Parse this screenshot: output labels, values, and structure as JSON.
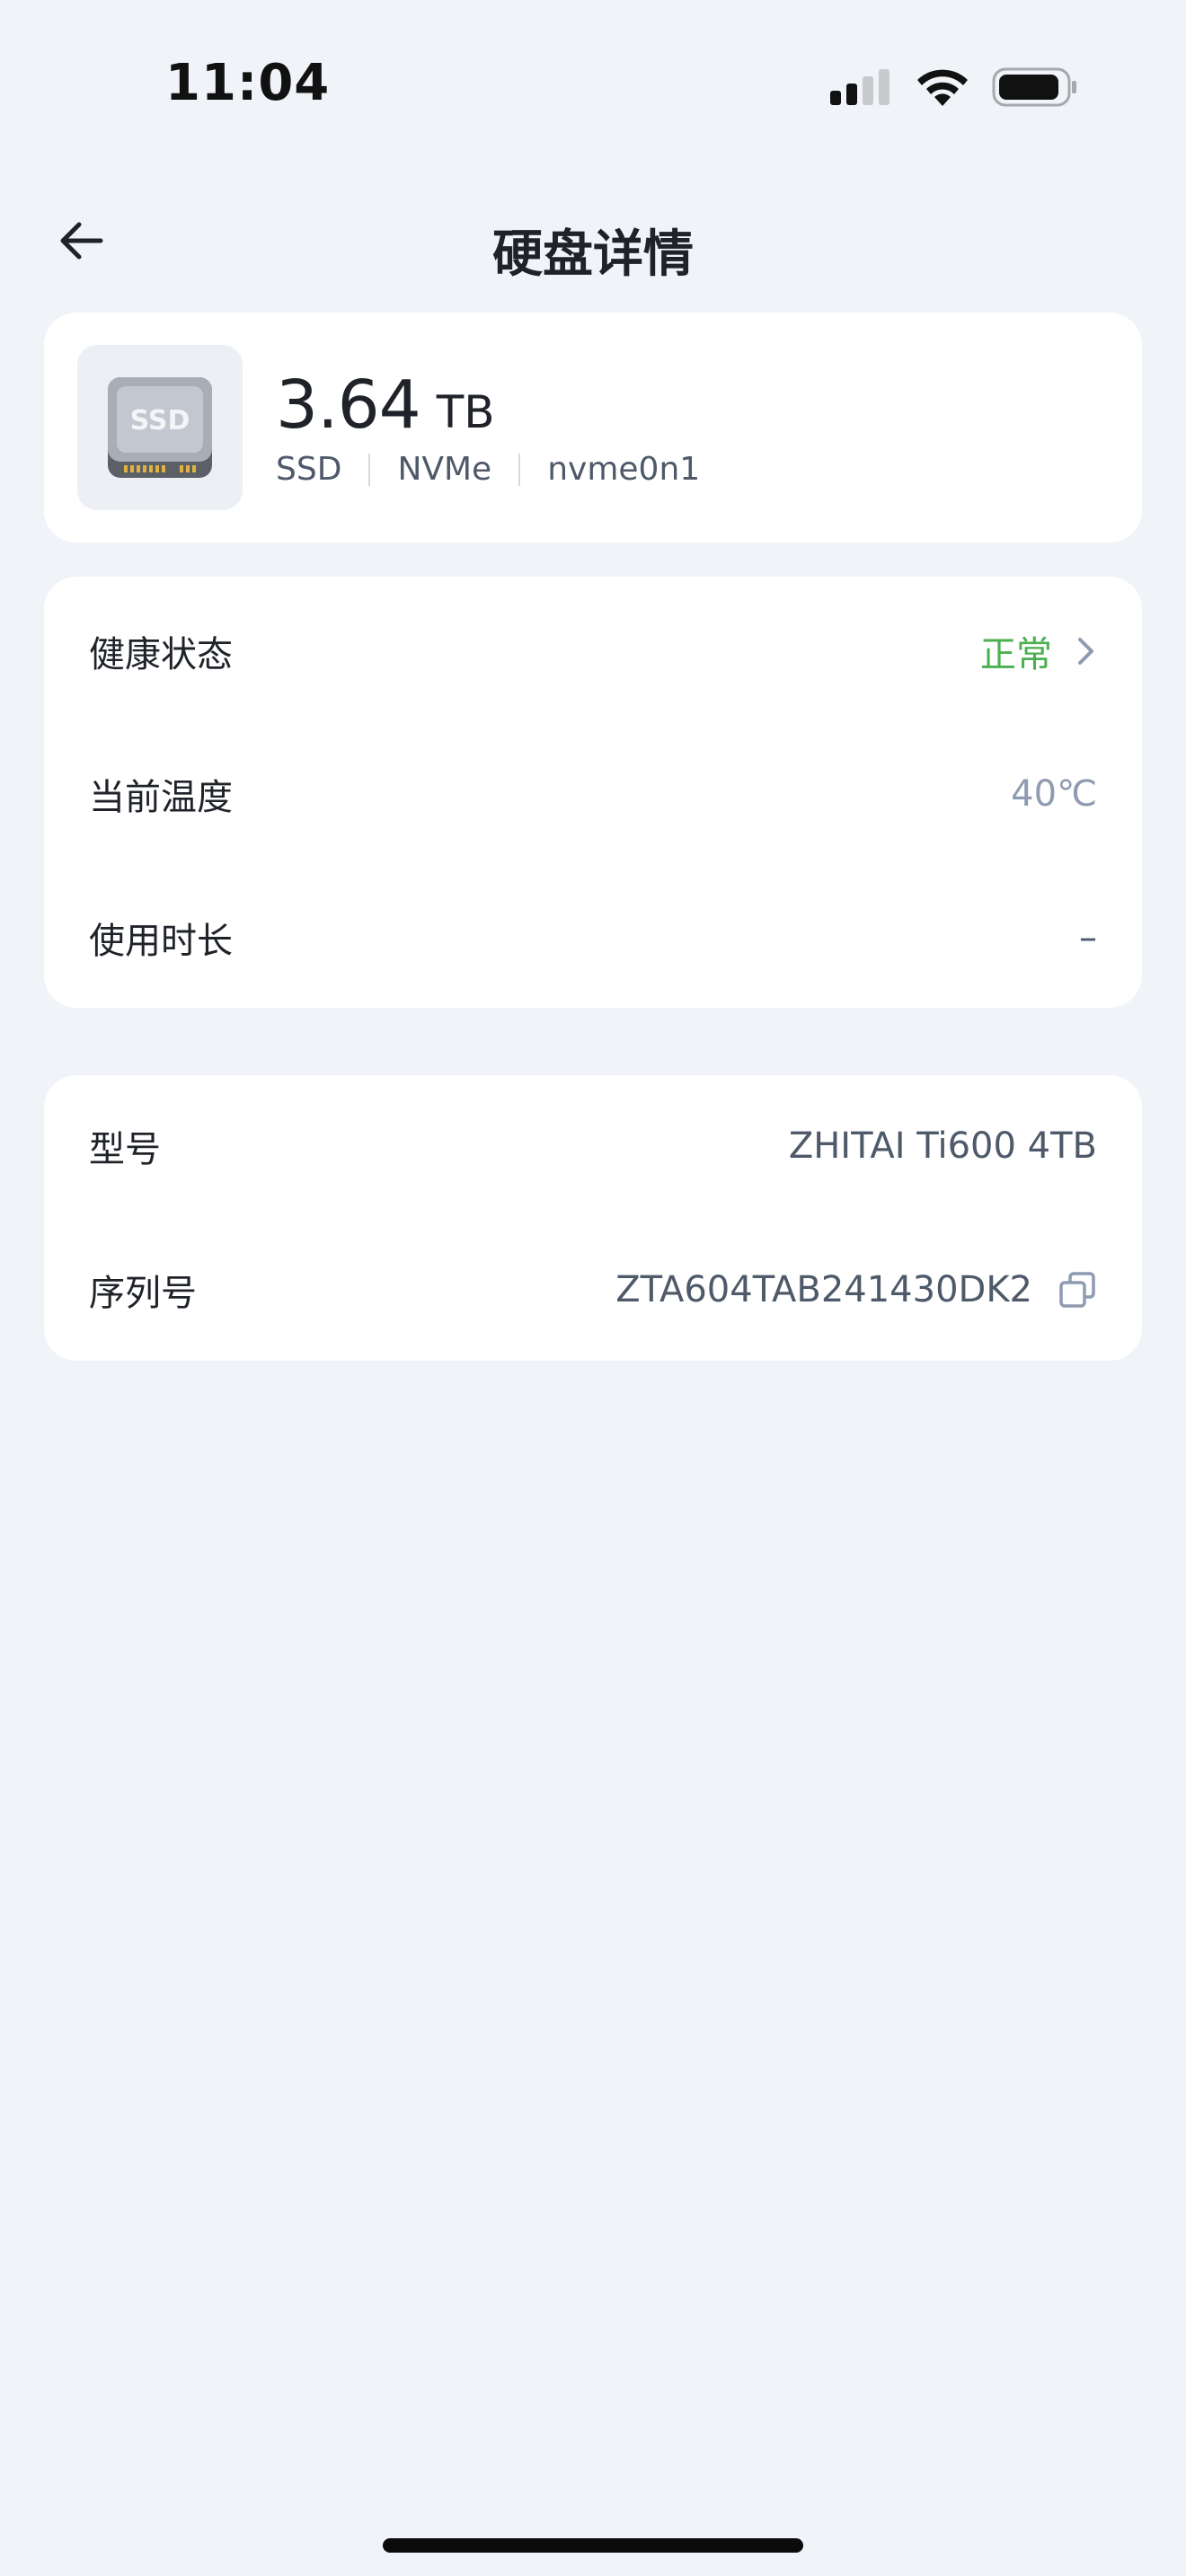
{
  "status_bar": {
    "time": "11:04"
  },
  "nav": {
    "title": "硬盘详情",
    "back_icon": "arrow-left-icon"
  },
  "disk": {
    "icon_label": "SSD",
    "capacity_value": "3.64",
    "capacity_unit": "TB",
    "type": "SSD",
    "interface": "NVMe",
    "device": "nvme0n1"
  },
  "status": {
    "health_label": "健康状态",
    "health_value": "正常",
    "temp_label": "当前温度",
    "temp_value": "40℃",
    "usage_label": "使用时长",
    "usage_value": "–"
  },
  "info": {
    "model_label": "型号",
    "model_value": "ZHITAI Ti600 4TB",
    "serial_label": "序列号",
    "serial_value": "ZTA604TAB241430DK2"
  },
  "colors": {
    "background": "#f0f3f8",
    "card": "#ffffff",
    "healthy": "#4caf50",
    "muted": "#8f9bb0",
    "text": "#1f2329",
    "secondary": "#4e5969"
  }
}
